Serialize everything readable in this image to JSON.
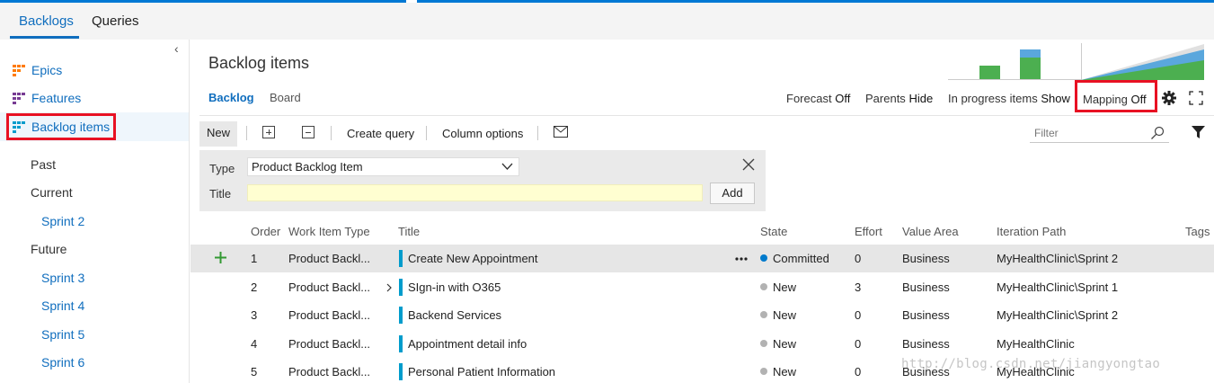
{
  "hub": {
    "tabs": [
      {
        "label": "Backlogs"
      },
      {
        "label": "Queries"
      }
    ]
  },
  "sidebar": {
    "collapse_glyph": "‹",
    "backlog_levels": [
      {
        "label": "Epics"
      },
      {
        "label": "Features"
      },
      {
        "label": "Backlog items"
      }
    ],
    "iterations": {
      "past": "Past",
      "current": "Current",
      "current_sprints": [
        "Sprint 2"
      ],
      "future": "Future",
      "future_sprints": [
        "Sprint 3",
        "Sprint 4",
        "Sprint 5",
        "Sprint 6"
      ]
    }
  },
  "header": {
    "title": "Backlog items",
    "pivots": [
      {
        "label": "Backlog"
      },
      {
        "label": "Board"
      }
    ],
    "options": [
      {
        "label": "Forecast",
        "value": "Off"
      },
      {
        "label": "Parents",
        "value": "Hide"
      },
      {
        "label": "In progress items",
        "value": "Show"
      },
      {
        "label": "Mapping",
        "value": "Off"
      }
    ]
  },
  "toolbar": {
    "new_label": "New",
    "create_query_label": "Create query",
    "column_options_label": "Column options",
    "filter_placeholder": "Filter"
  },
  "add_panel": {
    "type_label": "Type",
    "type_value": "Product Backlog Item",
    "title_label": "Title",
    "add_label": "Add"
  },
  "grid": {
    "columns": [
      "Order",
      "Work Item Type",
      "Title",
      "State",
      "Effort",
      "Value Area",
      "Iteration Path",
      "Tags"
    ],
    "rows": [
      {
        "order": "1",
        "type": "Product Backl...",
        "title": "Create New Appointment",
        "state": "Committed",
        "effort": "0",
        "value_area": "Business",
        "iteration": "MyHealthClinic\\Sprint 2"
      },
      {
        "order": "2",
        "type": "Product Backl...",
        "title": "SIgn-in with O365",
        "state": "New",
        "effort": "3",
        "value_area": "Business",
        "iteration": "MyHealthClinic\\Sprint 1"
      },
      {
        "order": "3",
        "type": "Product Backl...",
        "title": "Backend Services",
        "state": "New",
        "effort": "0",
        "value_area": "Business",
        "iteration": "MyHealthClinic\\Sprint 2"
      },
      {
        "order": "4",
        "type": "Product Backl...",
        "title": "Appointment detail info",
        "state": "New",
        "effort": "0",
        "value_area": "Business",
        "iteration": "MyHealthClinic"
      },
      {
        "order": "5",
        "type": "Product Backl...",
        "title": "Personal Patient Information",
        "state": "New",
        "effort": "0",
        "value_area": "Business",
        "iteration": "MyHealthClinic"
      }
    ]
  },
  "watermark": "http://blog.csdn.net/jiangyongtao",
  "colors": {
    "accent": "#106ebe",
    "highlight_box": "#e81123",
    "state_committed": "#007acc",
    "state_new": "#b2b2b2",
    "pbi_bar": "#009ccc",
    "add_plus": "#339933",
    "chart_green": "#4caf50",
    "chart_blue": "#5aa7dd"
  },
  "icons": {
    "epics": "epic-icon",
    "features": "feature-icon",
    "backlog_items": "backlog-item-icon",
    "settings": "gear-icon",
    "fullscreen": "fullscreen-icon",
    "filter": "funnel-icon",
    "search": "search-icon",
    "email": "mail-icon",
    "more": "ellipsis-icon",
    "expand": "chevron-right-icon",
    "add_row": "plus-icon",
    "dropdown": "chevron-down-icon",
    "close": "close-icon"
  }
}
